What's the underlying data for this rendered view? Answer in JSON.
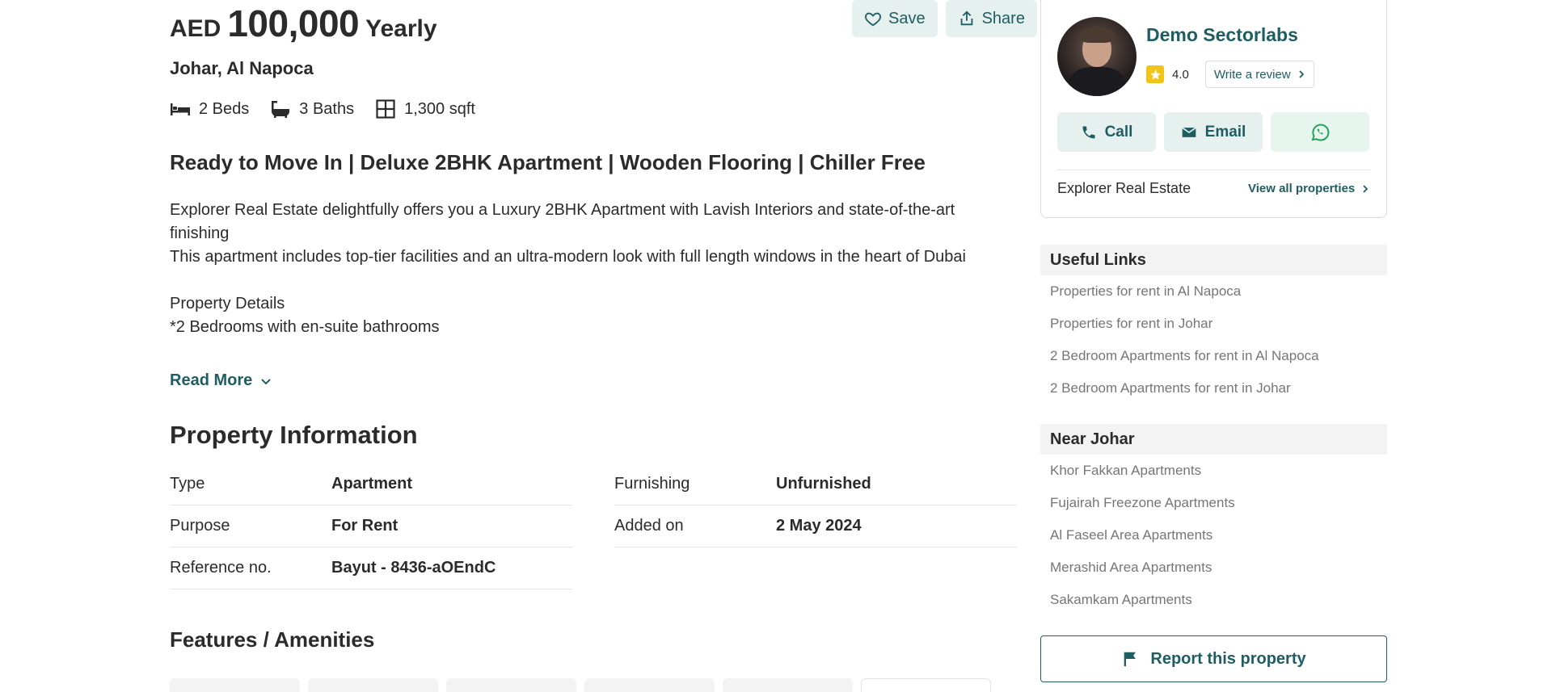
{
  "listing": {
    "currency": "AED",
    "price": "100,000",
    "period": "Yearly",
    "location": "Johar, Al Napoca",
    "beds": "2 Beds",
    "baths": "3 Baths",
    "area": "1,300 sqft",
    "headline": "Ready to Move In | Deluxe 2BHK Apartment | Wooden Flooring | Chiller Free",
    "description": {
      "line1": "Explorer Real Estate delightfully offers you a Luxury 2BHK Apartment with Lavish Interiors and state-of-the-art finishing",
      "line2": "This apartment includes top-tier facilities and an ultra-modern look with full length windows in the heart of Dubai",
      "line3": "Property Details",
      "line4": "*2 Bedrooms with en-suite bathrooms"
    },
    "read_more": "Read More"
  },
  "actions": {
    "save": "Save",
    "share": "Share"
  },
  "property_info": {
    "title": "Property Information",
    "left": [
      {
        "label": "Type",
        "value": "Apartment"
      },
      {
        "label": "Purpose",
        "value": "For Rent"
      },
      {
        "label": "Reference no.",
        "value": "Bayut - 8436-aOEndC"
      }
    ],
    "right": [
      {
        "label": "Furnishing",
        "value": "Unfurnished"
      },
      {
        "label": "Added on",
        "value": "2 May 2024"
      }
    ]
  },
  "features": {
    "title": "Features / Amenities"
  },
  "agent": {
    "name": "Demo Sectorlabs",
    "rating": "4.0",
    "write_review": "Write a review",
    "call": "Call",
    "email": "Email",
    "agency": "Explorer Real Estate",
    "view_all": "View all properties"
  },
  "useful_links": {
    "title": "Useful Links",
    "items": [
      "Properties for rent in Al Napoca",
      "Properties for rent in Johar",
      "2 Bedroom Apartments for rent in Al Napoca",
      "2 Bedroom Apartments for rent in Johar"
    ]
  },
  "near": {
    "title": "Near Johar",
    "items": [
      "Khor Fakkan Apartments",
      "Fujairah Freezone Apartments",
      "Al Faseel Area Apartments",
      "Merashid Area Apartments",
      "Sakamkam Apartments"
    ]
  },
  "report": "Report this property",
  "colors": {
    "accent": "#1e5e63",
    "button_bg": "#e6f0ef",
    "star": "#f0c419",
    "whatsapp": "#25a35a"
  }
}
